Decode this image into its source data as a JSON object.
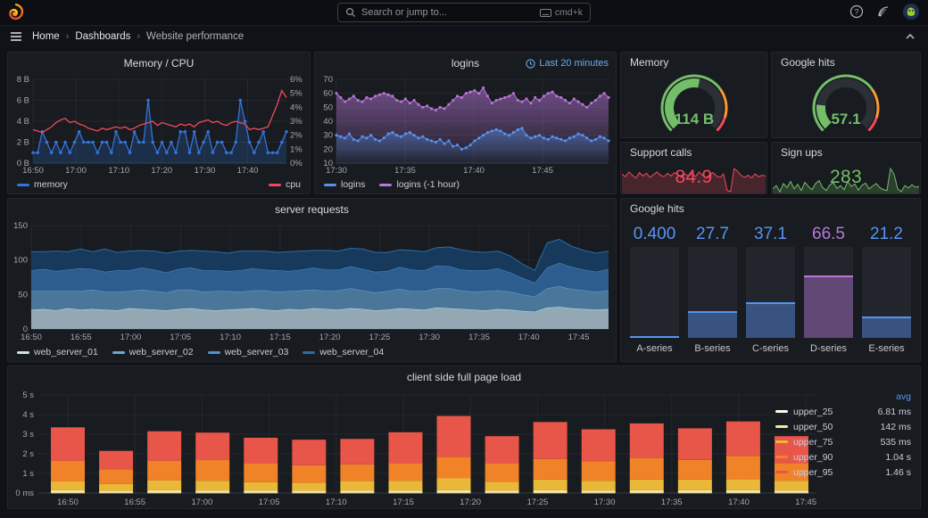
{
  "topbar": {
    "search_placeholder": "Search or jump to...",
    "shortcut": "cmd+k",
    "icons": [
      "help-icon",
      "news-icon",
      "user-avatar"
    ]
  },
  "breadcrumb": {
    "items": [
      "Home",
      "Dashboards",
      "Website performance"
    ]
  },
  "colors": {
    "blue": "#3274D9",
    "light_blue": "#5794F2",
    "purple": "#B877D9",
    "green": "#73BF69",
    "orange": "#FF9830",
    "red": "#F2495C",
    "panel_bg": "#181B1F",
    "page_bg": "#111217"
  },
  "chart_data": [
    {
      "id": "memory_cpu",
      "type": "line",
      "title": "Memory / CPU",
      "x_ticks": [
        "16:50",
        "17:00",
        "17:10",
        "17:20",
        "17:30",
        "17:40"
      ],
      "x_tick_fracs": [
        0,
        0.169,
        0.339,
        0.508,
        0.678,
        0.847
      ],
      "y_left": {
        "ticks": [
          "0 B",
          "2 B",
          "4 B",
          "6 B",
          "8 B"
        ],
        "min": 0,
        "max": 8
      },
      "y_right": {
        "ticks": [
          "0%",
          "1%",
          "2%",
          "3%",
          "4%",
          "5%",
          "6%"
        ],
        "min": 0,
        "max": 6
      },
      "legend_position": "bottom-spread",
      "series": [
        {
          "name": "memory",
          "color": "#3274D9",
          "axis": "left",
          "markers": true,
          "values": [
            1,
            1,
            3,
            2,
            1,
            2,
            1,
            2,
            1,
            2,
            3,
            2,
            2,
            2,
            1,
            2,
            2,
            1,
            3,
            2,
            2,
            1,
            3,
            2,
            2,
            6,
            2,
            1,
            2,
            1,
            2,
            1,
            3,
            3,
            1,
            3,
            1,
            2,
            3,
            1,
            2,
            2,
            1,
            1,
            2,
            6,
            4,
            2,
            1,
            2,
            3,
            1,
            1,
            1,
            2,
            3
          ]
        },
        {
          "name": "cpu",
          "color": "#F2495C",
          "axis": "right",
          "markers": false,
          "values": [
            2.4,
            2.3,
            2.2,
            2.4,
            2.6,
            2.9,
            3.1,
            3.2,
            2.9,
            3.0,
            2.8,
            2.7,
            2.5,
            2.4,
            2.3,
            2.5,
            2.4,
            2.5,
            2.6,
            2.5,
            2.6,
            2.4,
            2.5,
            2.7,
            2.8,
            2.9,
            3.0,
            2.7,
            2.9,
            2.8,
            2.7,
            2.6,
            2.8,
            2.7,
            2.8,
            2.6,
            2.9,
            3.0,
            3.1,
            2.9,
            3.0,
            2.8,
            2.7,
            2.9,
            3.0,
            2.9,
            2.8,
            2.4,
            2.5,
            2.4,
            2.5,
            2.6,
            3.4,
            4.2,
            5.2,
            4.7
          ]
        }
      ]
    },
    {
      "id": "logins",
      "type": "line",
      "title": "logins",
      "timerange": "Last 20 minutes",
      "x_ticks": [
        "17:30",
        "17:35",
        "17:40",
        "17:45"
      ],
      "x_tick_fracs": [
        0,
        0.2525,
        0.505,
        0.7576
      ],
      "y": {
        "ticks": [
          "10",
          "20",
          "30",
          "40",
          "50",
          "60",
          "70"
        ],
        "min": 10,
        "max": 70
      },
      "series": [
        {
          "name": "logins",
          "color": "#5794F2",
          "values": [
            30,
            29,
            28,
            31,
            27,
            26,
            29,
            28,
            30,
            27,
            26,
            28,
            31,
            32,
            30,
            29,
            31,
            32,
            30,
            28,
            29,
            27,
            26,
            25,
            27,
            24,
            26,
            22,
            23,
            20,
            21,
            23,
            26,
            28,
            30,
            32,
            33,
            34,
            33,
            31,
            30,
            32,
            34,
            35,
            30,
            28,
            29,
            30,
            28,
            27,
            29,
            28,
            27,
            26,
            28,
            29,
            31,
            30,
            28,
            26,
            27,
            29,
            28,
            26
          ]
        },
        {
          "name": "logins (-1 hour)",
          "color": "#B877D9",
          "values": [
            60,
            57,
            54,
            56,
            58,
            55,
            54,
            57,
            56,
            58,
            59,
            60,
            59,
            58,
            55,
            54,
            56,
            53,
            55,
            52,
            50,
            51,
            49,
            48,
            50,
            49,
            52,
            55,
            58,
            57,
            60,
            61,
            62,
            60,
            64,
            58,
            53,
            55,
            56,
            57,
            58,
            60,
            55,
            54,
            56,
            53,
            57,
            55,
            58,
            60,
            61,
            58,
            57,
            55,
            53,
            56,
            54,
            52,
            50,
            53,
            55,
            58,
            60,
            57
          ]
        }
      ]
    },
    {
      "id": "memory_gauge",
      "type": "gauge",
      "title": "Memory",
      "value": "114 B",
      "color": "#73BF69",
      "fraction": 0.54,
      "thresholds": [
        {
          "to": 0.7,
          "color": "#73BF69"
        },
        {
          "to": 0.9,
          "color": "#FF9830"
        },
        {
          "to": 1,
          "color": "#F2495C"
        }
      ]
    },
    {
      "id": "google_gauge",
      "type": "gauge",
      "title": "Google hits",
      "value": "57.1",
      "color": "#73BF69",
      "fraction": 0.19,
      "thresholds": [
        {
          "to": 0.7,
          "color": "#73BF69"
        },
        {
          "to": 0.9,
          "color": "#FF9830"
        },
        {
          "to": 1,
          "color": "#F2495C"
        }
      ]
    },
    {
      "id": "support_calls",
      "type": "stat",
      "title": "Support calls",
      "value": "84.9",
      "color": "#F2495C",
      "spark": [
        82,
        78,
        85,
        80,
        76,
        84,
        79,
        83,
        77,
        81,
        85,
        80,
        78,
        83,
        79,
        84,
        81,
        77,
        82,
        79,
        83,
        78,
        85,
        80,
        76,
        81,
        84,
        79,
        77,
        82,
        58,
        56,
        90,
        86,
        80,
        77,
        80,
        76,
        82,
        78,
        80,
        79
      ]
    },
    {
      "id": "sign_ups",
      "type": "stat",
      "title": "Sign ups",
      "value": "283",
      "color": "#73BF69",
      "spark": [
        272,
        280,
        265,
        285,
        275,
        290,
        272,
        283,
        268,
        288,
        278,
        270,
        285,
        292,
        275,
        268,
        282,
        287,
        273,
        280,
        270,
        290,
        278,
        284,
        269,
        281,
        286,
        272,
        279,
        285,
        275,
        270,
        268,
        322,
        308,
        272,
        265,
        280,
        274,
        282,
        276,
        278
      ]
    },
    {
      "id": "server_requests",
      "type": "stacked_area",
      "title": "server requests",
      "x_ticks": [
        "16:50",
        "16:55",
        "17:00",
        "17:05",
        "17:10",
        "17:15",
        "17:20",
        "17:25",
        "17:30",
        "17:35",
        "17:40",
        "17:45"
      ],
      "y": {
        "ticks": [
          "0",
          "50",
          "100",
          "150"
        ],
        "min": 0,
        "max": 150
      },
      "series": [
        {
          "name": "web_server_01",
          "fill": "#94A8B4",
          "line": "#CFE0EA",
          "values": [
            28,
            29,
            27,
            30,
            28,
            29,
            28,
            27,
            30,
            29,
            28,
            27,
            29,
            30,
            28,
            27,
            28,
            29,
            30,
            28,
            27,
            29,
            28,
            30,
            29,
            28,
            30,
            29,
            27,
            28,
            30,
            29,
            28,
            31,
            30,
            29,
            28,
            27,
            29,
            28,
            26,
            25,
            31,
            32,
            30,
            29,
            28,
            29
          ]
        },
        {
          "name": "web_server_02",
          "fill": "#4A7699",
          "line": "#6FA8CC",
          "values": [
            27,
            26,
            28,
            25,
            27,
            28,
            26,
            27,
            25,
            28,
            27,
            26,
            28,
            27,
            26,
            28,
            27,
            25,
            26,
            28,
            27,
            26,
            28,
            27,
            26,
            28,
            29,
            27,
            26,
            27,
            28,
            26,
            27,
            28,
            29,
            27,
            26,
            28,
            27,
            26,
            24,
            22,
            28,
            30,
            28,
            27,
            26,
            27
          ]
        },
        {
          "name": "web_server_03",
          "fill": "#2C5D8E",
          "line": "#4E92D1",
          "values": [
            30,
            32,
            29,
            31,
            33,
            30,
            29,
            31,
            30,
            32,
            31,
            29,
            30,
            32,
            31,
            30,
            29,
            31,
            32,
            30,
            31,
            29,
            30,
            32,
            31,
            30,
            32,
            31,
            30,
            29,
            32,
            31,
            30,
            33,
            32,
            30,
            31,
            30,
            32,
            28,
            24,
            20,
            30,
            34,
            32,
            30,
            29,
            31
          ]
        },
        {
          "name": "web_server_04",
          "fill": "#16395C",
          "line": "#2E6DA4",
          "values": [
            27,
            25,
            29,
            26,
            28,
            25,
            33,
            26,
            28,
            25,
            27,
            28,
            26,
            25,
            28,
            27,
            26,
            28,
            25,
            27,
            26,
            28,
            27,
            25,
            28,
            27,
            26,
            29,
            28,
            27,
            25,
            28,
            27,
            26,
            28,
            29,
            27,
            26,
            25,
            24,
            20,
            18,
            36,
            34,
            30,
            28,
            27,
            26
          ]
        }
      ]
    },
    {
      "id": "google_bars",
      "type": "bar_gauge",
      "title": "Google hits",
      "max": 100,
      "bars": [
        {
          "label": "A-series",
          "value": "0.400",
          "numeric": 0.4,
          "color": "#5794F2"
        },
        {
          "label": "B-series",
          "value": "27.7",
          "numeric": 27.7,
          "color": "#5794F2"
        },
        {
          "label": "C-series",
          "value": "37.1",
          "numeric": 37.1,
          "color": "#5794F2"
        },
        {
          "label": "D-series",
          "value": "66.5",
          "numeric": 66.5,
          "color": "#B877D9"
        },
        {
          "label": "E-series",
          "value": "21.2",
          "numeric": 21.2,
          "color": "#5794F2"
        }
      ]
    },
    {
      "id": "client_load",
      "type": "stacked_bar",
      "title": "client side full page load",
      "x_ticks": [
        "16:50",
        "16:55",
        "17:00",
        "17:05",
        "17:10",
        "17:15",
        "17:20",
        "17:25",
        "17:30",
        "17:35",
        "17:40",
        "17:45"
      ],
      "y_ticks": [
        "0 ms",
        "1 s",
        "2 s",
        "3 s",
        "4 s",
        "5 s"
      ],
      "ymax": 5,
      "legend_header": "avg",
      "legend": [
        {
          "name": "upper_25",
          "avg": "6.81 ms",
          "color": "#FFFCF0"
        },
        {
          "name": "upper_50",
          "avg": "142 ms",
          "color": "#F7E8A0"
        },
        {
          "name": "upper_75",
          "avg": "535 ms",
          "color": "#EAB839"
        },
        {
          "name": "upper_90",
          "avg": "1.04 s",
          "color": "#F08228"
        },
        {
          "name": "upper_95",
          "avg": "1.46 s",
          "color": "#E85549"
        }
      ],
      "bars": [
        [
          0.01,
          0.13,
          0.45,
          1.05,
          1.71
        ],
        [
          0.01,
          0.1,
          0.35,
          0.75,
          0.94
        ],
        [
          0.01,
          0.13,
          0.5,
          1.0,
          1.51
        ],
        [
          0.01,
          0.12,
          0.5,
          1.05,
          1.4
        ],
        [
          0.01,
          0.12,
          0.42,
          0.95,
          1.32
        ],
        [
          0.01,
          0.11,
          0.4,
          0.9,
          1.3
        ],
        [
          0.01,
          0.12,
          0.48,
          0.85,
          1.3
        ],
        [
          0.01,
          0.12,
          0.5,
          0.9,
          1.57
        ],
        [
          0.01,
          0.14,
          0.6,
          1.1,
          2.08
        ],
        [
          0.01,
          0.12,
          0.45,
          0.95,
          1.37
        ],
        [
          0.01,
          0.13,
          0.55,
          1.05,
          1.88
        ],
        [
          0.01,
          0.12,
          0.5,
          1.0,
          1.62
        ],
        [
          0.01,
          0.13,
          0.55,
          1.1,
          1.76
        ],
        [
          0.01,
          0.13,
          0.55,
          1.0,
          1.61
        ],
        [
          0.01,
          0.14,
          0.55,
          1.2,
          1.75
        ],
        [
          0.01,
          0.12,
          0.5,
          0.9,
          1.37
        ]
      ]
    }
  ]
}
